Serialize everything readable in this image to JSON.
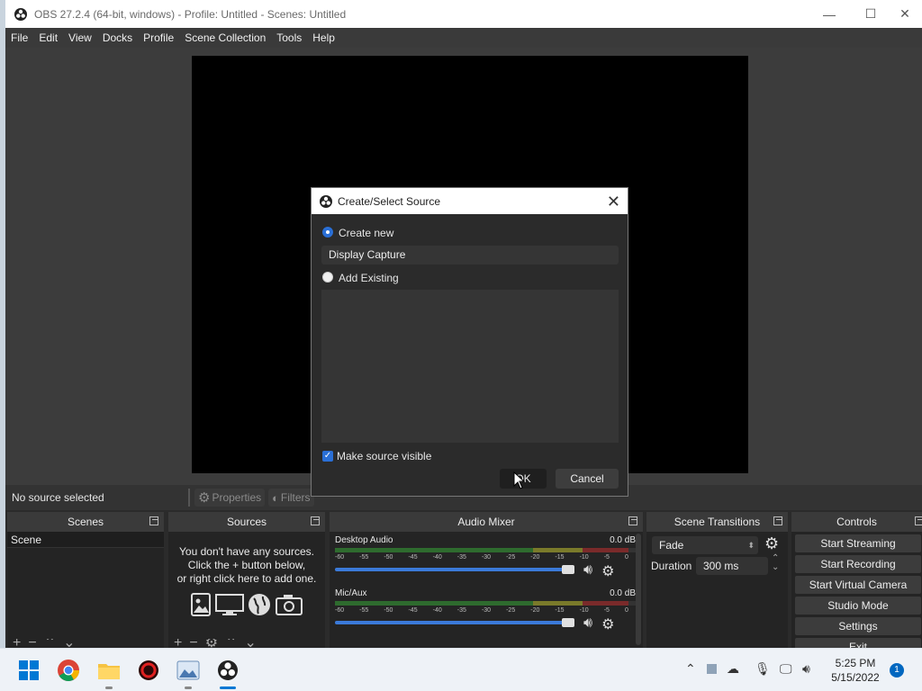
{
  "window": {
    "title": "OBS 27.2.4 (64-bit, windows) - Profile: Untitled - Scenes: Untitled",
    "minimize": "—",
    "maximize": "☐",
    "close": "✕"
  },
  "menu": [
    "File",
    "Edit",
    "View",
    "Docks",
    "Profile",
    "Scene Collection",
    "Tools",
    "Help"
  ],
  "source_toolbar": {
    "status": "No source selected",
    "properties": "Properties",
    "filters": "Filters"
  },
  "docks": {
    "scenes": {
      "title": "Scenes",
      "items": [
        "Scene"
      ]
    },
    "sources": {
      "title": "Sources",
      "empty_line1": "You don't have any sources.",
      "empty_line2": "Click the + button below,",
      "empty_line3": "or right click here to add one."
    },
    "audio_mixer": {
      "title": "Audio Mixer",
      "ticks": [
        "-60",
        "-55",
        "-50",
        "-45",
        "-40",
        "-35",
        "-30",
        "-25",
        "-20",
        "-15",
        "-10",
        "-5",
        "0"
      ],
      "channels": [
        {
          "name": "Desktop Audio",
          "db": "0.0 dB",
          "volume": 1.0
        },
        {
          "name": "Mic/Aux",
          "db": "0.0 dB",
          "volume": 1.0
        }
      ]
    },
    "transitions": {
      "title": "Scene Transitions",
      "selected": "Fade",
      "duration_label": "Duration",
      "duration_value": "300 ms"
    },
    "controls": {
      "title": "Controls",
      "buttons": [
        "Start Streaming",
        "Start Recording",
        "Start Virtual Camera",
        "Studio Mode",
        "Settings",
        "Exit"
      ]
    }
  },
  "dialog": {
    "title": "Create/Select Source",
    "create_new_label": "Create new",
    "name_value": "Display Capture",
    "add_existing_label": "Add Existing",
    "make_visible_label": "Make source visible",
    "ok_label": "OK",
    "cancel_label": "Cancel"
  },
  "taskbar": {
    "time": "5:25 PM",
    "date": "5/15/2022",
    "notifications": "1"
  },
  "colors": {
    "accent": "#2a6fd6",
    "obs_bg": "#2b2b2b",
    "preview": "#000000"
  }
}
